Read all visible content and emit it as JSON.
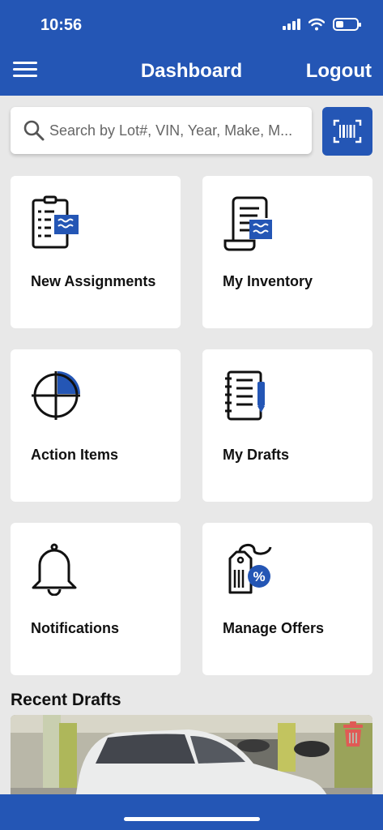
{
  "status": {
    "time": "10:56"
  },
  "header": {
    "title": "Dashboard",
    "logout_label": "Logout"
  },
  "search": {
    "placeholder": "Search by Lot#, VIN, Year, Make, M..."
  },
  "tiles": [
    {
      "label": "New Assignments",
      "icon": "document-list-icon"
    },
    {
      "label": "My Inventory",
      "icon": "scroll-document-icon"
    },
    {
      "label": "Action Items",
      "icon": "pie-target-icon"
    },
    {
      "label": "My Drafts",
      "icon": "notebook-pen-icon"
    },
    {
      "label": "Notifications",
      "icon": "bell-icon"
    },
    {
      "label": "Manage Offers",
      "icon": "price-tag-percent-icon"
    }
  ],
  "recent": {
    "title": "Recent Drafts"
  },
  "colors": {
    "brand": "#2456b5",
    "background": "#e8e8e8",
    "delete": "#e05a55"
  }
}
